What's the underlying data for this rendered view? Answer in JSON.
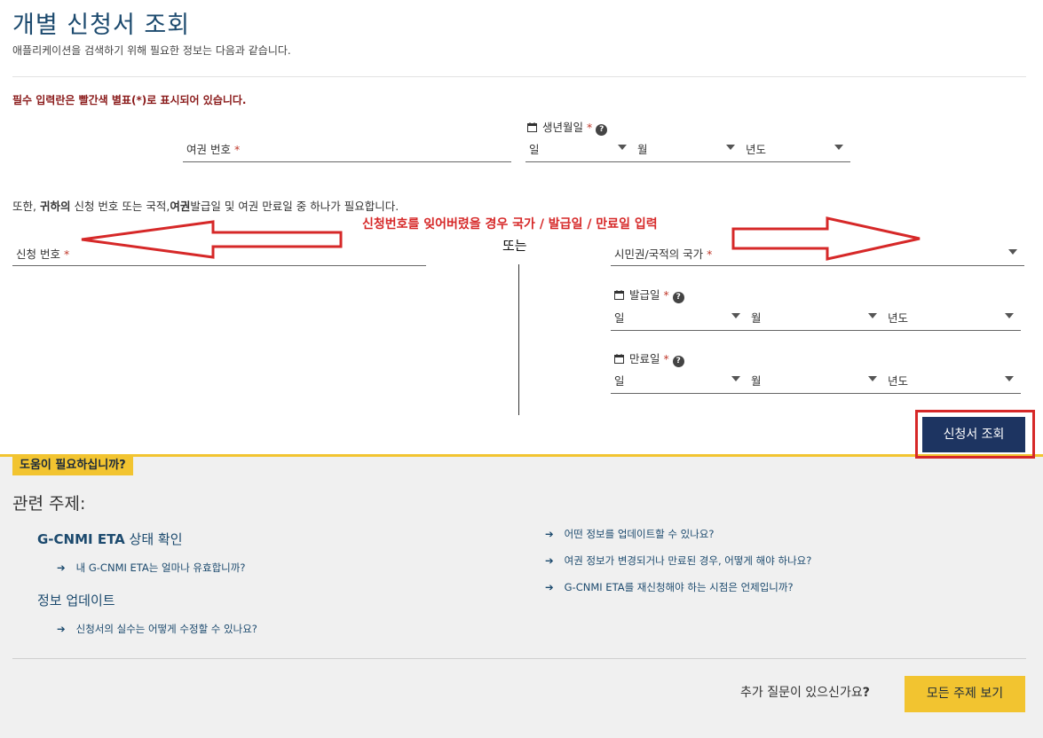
{
  "page": {
    "title": "개별 신청서 조회",
    "subtitle": "애플리케이션을 검색하기 위해 필요한 정보는 다음과 같습니다.",
    "required_note": "필수 입력란은 빨간색 별표(*)로 표시되어 있습니다."
  },
  "form": {
    "passport_label": "여권 번호",
    "required_mark": "*",
    "dob_label": "생년월일",
    "day": "일",
    "month": "월",
    "year": "년도",
    "also_note_pre": "또한, ",
    "also_note_bold1": "귀하의",
    "also_note_mid": " 신청 번호 또는 국적,",
    "also_note_bold2": "여권",
    "also_note_post": "발급일 및 여권 만료일 중 하나가 필요합니다.",
    "application_number_label": "신청 번호",
    "or_text": "또는",
    "citizenship_label": "시민권/국적의 국가",
    "issue_date_label": "발급일",
    "expiry_date_label": "만료일",
    "help_glyph": "?",
    "submit_label": "신청서 조회"
  },
  "annotation": {
    "text": "신청번호를 잊어버렸을 경우 국가 / 발급일 / 만료일 입력",
    "color": "#d62828"
  },
  "help": {
    "badge": "도움이 필요하십니까?",
    "related_title": "관련 주제:",
    "topic1_bold": "G-CNMI ETA",
    "topic1_rest": " 상태 확인",
    "topic1_link": "내 G-CNMI ETA는 얼마나 유효합니까?",
    "topic2": "정보 업데이트",
    "topic2_link": "신청서의 실수는 어떻게 수정할 수 있나요?",
    "right_links": [
      "어떤 정보를 업데이트할 수 있나요?",
      "여권 정보가 변경되거나 만료된 경우, 어떻게 해야 하나요?",
      "G-CNMI ETA를 재신청해야 하는 시점은 언제입니까?"
    ],
    "arrow": "➔",
    "more_questions_pre": "추가 질문이 있으신가요",
    "more_questions_q": "?",
    "all_topics_label": "모든 주제 보기"
  },
  "colors": {
    "accent": "#1c4a6e",
    "button": "#1d3461",
    "yellow": "#f2c430",
    "required": "#c0392b"
  }
}
